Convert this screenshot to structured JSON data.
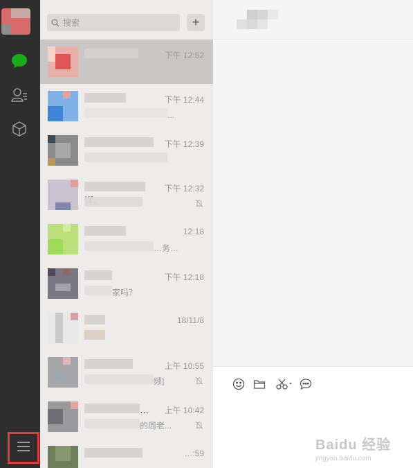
{
  "nav": {
    "icons": [
      "chat-icon",
      "contacts-icon",
      "favorites-icon",
      "menu-icon"
    ]
  },
  "search": {
    "placeholder": "搜索",
    "add_label": "+"
  },
  "chats": [
    {
      "time": "下午 12:52",
      "preview": "",
      "muted": false,
      "selected": true
    },
    {
      "time": "下午 12:44",
      "preview": "...",
      "muted": false,
      "selected": false
    },
    {
      "time": "下午 12:39",
      "preview": "",
      "muted": false,
      "selected": false
    },
    {
      "time": "下午 12:32",
      "name_tail": "详。",
      "preview": "",
      "muted": true,
      "selected": false
    },
    {
      "time": "12:18",
      "preview": "…务…",
      "muted": false,
      "selected": false
    },
    {
      "time": "下午 12:18",
      "preview": "家吗？",
      "muted": false,
      "selected": false
    },
    {
      "time": "18/11/8",
      "preview": "",
      "muted": false,
      "selected": false
    },
    {
      "time": "上午 10:55",
      "preview": "频]",
      "muted": true,
      "selected": false
    },
    {
      "time": "上午 10:42",
      "name_tail": "…",
      "preview": "的周老...",
      "muted": true,
      "selected": false
    },
    {
      "time": "…:59",
      "preview": "",
      "muted": false,
      "selected": false
    }
  ],
  "composer": {
    "tools": [
      "emoji-icon",
      "folder-icon",
      "scissors-icon",
      "chat-bubble-icon"
    ]
  },
  "watermark": {
    "main": "Baidu 经验",
    "sub": "jingyan.baidu.com"
  },
  "colors": {
    "nav_bg": "#2e2e2e",
    "list_bg": "#eeecea",
    "selected_bg": "#c9c7c5",
    "accent_green": "#1aad19",
    "highlight_red": "#e53935"
  }
}
